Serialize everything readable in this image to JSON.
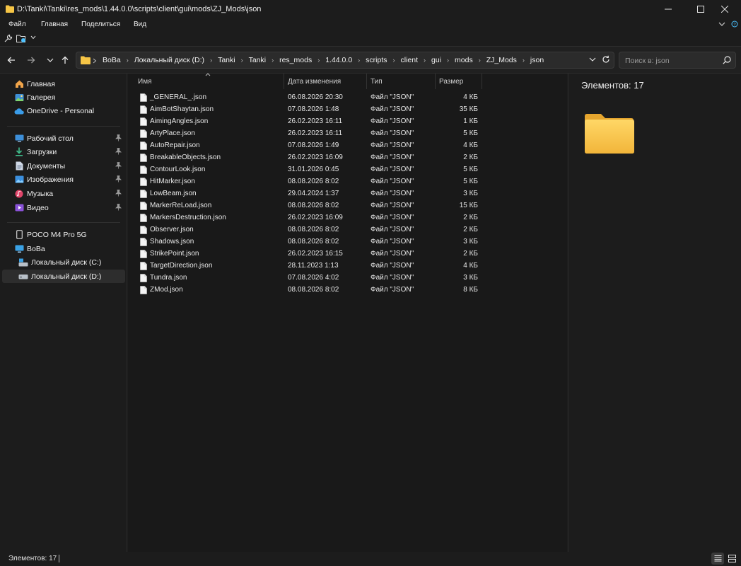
{
  "window": {
    "title": "D:\\Tanki\\Tanki\\res_mods\\1.44.0.0\\scripts\\client\\gui\\mods\\ZJ_Mods\\json"
  },
  "menu": [
    "Файл",
    "Главная",
    "Поделиться",
    "Вид"
  ],
  "breadcrumbs": [
    "BoBa",
    "Локальный диск (D:)",
    "Tanki",
    "Tanki",
    "res_mods",
    "1.44.0.0",
    "scripts",
    "client",
    "gui",
    "mods",
    "ZJ_Mods",
    "json"
  ],
  "search": {
    "placeholder": "Поиск в: json"
  },
  "sidebar": {
    "quick": [
      {
        "label": "Главная",
        "icon": "home-icon"
      },
      {
        "label": "Галерея",
        "icon": "gallery-icon"
      },
      {
        "label": "OneDrive - Personal",
        "icon": "cloud-icon"
      }
    ],
    "pinned": [
      {
        "label": "Рабочий стол",
        "icon": "desktop-icon"
      },
      {
        "label": "Загрузки",
        "icon": "download-icon"
      },
      {
        "label": "Документы",
        "icon": "documents-icon"
      },
      {
        "label": "Изображения",
        "icon": "pictures-icon"
      },
      {
        "label": "Музыка",
        "icon": "music-icon"
      },
      {
        "label": "Видео",
        "icon": "video-icon"
      }
    ],
    "devices": [
      {
        "label": "POCO M4 Pro 5G",
        "icon": "phone-icon"
      },
      {
        "label": "BoBa",
        "icon": "computer-icon"
      },
      {
        "label": "Локальный диск (C:)",
        "icon": "drive-icon"
      },
      {
        "label": "Локальный диск (D:)",
        "icon": "drive-icon",
        "active": true
      }
    ]
  },
  "columns": {
    "name": "Имя",
    "date": "Дата изменения",
    "type": "Тип",
    "size": "Размер"
  },
  "files": [
    {
      "name": "_GENERAL_.json",
      "date": "06.08.2026 20:30",
      "type": "Файл \"JSON\"",
      "size": "4 КБ"
    },
    {
      "name": "AimBotShaytan.json",
      "date": "07.08.2026 1:48",
      "type": "Файл \"JSON\"",
      "size": "35 КБ"
    },
    {
      "name": "AimingAngles.json",
      "date": "26.02.2023 16:11",
      "type": "Файл \"JSON\"",
      "size": "1 КБ"
    },
    {
      "name": "ArtyPlace.json",
      "date": "26.02.2023 16:11",
      "type": "Файл \"JSON\"",
      "size": "5 КБ"
    },
    {
      "name": "AutoRepair.json",
      "date": "07.08.2026 1:49",
      "type": "Файл \"JSON\"",
      "size": "4 КБ"
    },
    {
      "name": "BreakableObjects.json",
      "date": "26.02.2023 16:09",
      "type": "Файл \"JSON\"",
      "size": "2 КБ"
    },
    {
      "name": "ContourLook.json",
      "date": "31.01.2026 0:45",
      "type": "Файл \"JSON\"",
      "size": "5 КБ"
    },
    {
      "name": "HitMarker.json",
      "date": "08.08.2026 8:02",
      "type": "Файл \"JSON\"",
      "size": "5 КБ"
    },
    {
      "name": "LowBeam.json",
      "date": "29.04.2024 1:37",
      "type": "Файл \"JSON\"",
      "size": "3 КБ"
    },
    {
      "name": "MarkerReLoad.json",
      "date": "08.08.2026 8:02",
      "type": "Файл \"JSON\"",
      "size": "15 КБ"
    },
    {
      "name": "MarkersDestruction.json",
      "date": "26.02.2023 16:09",
      "type": "Файл \"JSON\"",
      "size": "2 КБ"
    },
    {
      "name": "Observer.json",
      "date": "08.08.2026 8:02",
      "type": "Файл \"JSON\"",
      "size": "2 КБ"
    },
    {
      "name": "Shadows.json",
      "date": "08.08.2026 8:02",
      "type": "Файл \"JSON\"",
      "size": "3 КБ"
    },
    {
      "name": "StrikePoint.json",
      "date": "26.02.2023 16:15",
      "type": "Файл \"JSON\"",
      "size": "2 КБ"
    },
    {
      "name": "TargetDirection.json",
      "date": "28.11.2023 1:13",
      "type": "Файл \"JSON\"",
      "size": "4 КБ"
    },
    {
      "name": "Tundra.json",
      "date": "07.08.2026 4:02",
      "type": "Файл \"JSON\"",
      "size": "3 КБ"
    },
    {
      "name": "ZMod.json",
      "date": "08.08.2026 8:02",
      "type": "Файл \"JSON\"",
      "size": "8 КБ"
    }
  ],
  "details": {
    "count_label": "Элементов: 17"
  },
  "status": {
    "text": "Элементов: 17"
  },
  "colors": {
    "folder": "#f6c546",
    "accent": "#4cc2ff",
    "background": "#191919"
  }
}
